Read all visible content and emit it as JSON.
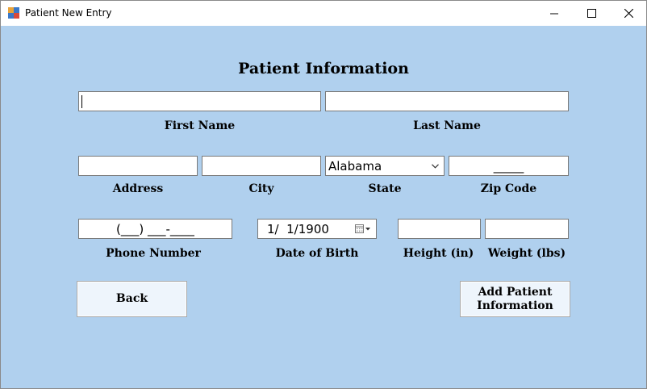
{
  "window": {
    "title": "Patient New Entry",
    "background": "#b0d0ee"
  },
  "form": {
    "title": "Patient Information",
    "fields": {
      "first_name": {
        "label": "First Name",
        "value": ""
      },
      "last_name": {
        "label": "Last Name",
        "value": ""
      },
      "address": {
        "label": "Address",
        "value": ""
      },
      "city": {
        "label": "City",
        "value": ""
      },
      "state": {
        "label": "State",
        "value": "Alabama"
      },
      "zip": {
        "label": "Zip Code",
        "mask": "_____"
      },
      "phone": {
        "label": "Phone Number",
        "mask": "(___) ___-____"
      },
      "dob": {
        "label": "Date of Birth",
        "value": "1/  1/1900"
      },
      "height": {
        "label": "Height (in)",
        "value": ""
      },
      "weight": {
        "label": "Weight (lbs)",
        "value": ""
      }
    },
    "buttons": {
      "back": "Back",
      "add": "Add Patient Information"
    }
  },
  "icons": {
    "app": "app-window-icon",
    "minimize": "minimize-icon",
    "maximize": "maximize-icon",
    "close": "close-icon",
    "dropdown": "chevron-down-icon",
    "calendar": "calendar-icon"
  }
}
